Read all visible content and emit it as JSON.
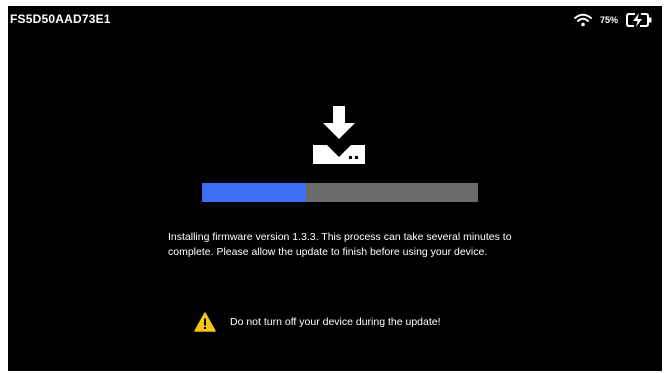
{
  "status_bar": {
    "device_id": "FS5D50AAD73E1",
    "wifi_icon": "wifi-icon",
    "battery_percent": "75%",
    "battery_icon": "battery-charging-icon"
  },
  "update": {
    "icon": "download-to-device-icon",
    "progress": 0.375,
    "progress_colors": {
      "fill": "#3e6ef5",
      "track": "#6b6b6b"
    },
    "message": "Installing firmware version 1.3.3. This process can take several minutes to complete. Please allow the update to finish before using your device.",
    "warning_icon": "warning-icon",
    "warning_color": "#f5c518",
    "warning_text": "Do not turn off your device during the update!"
  }
}
